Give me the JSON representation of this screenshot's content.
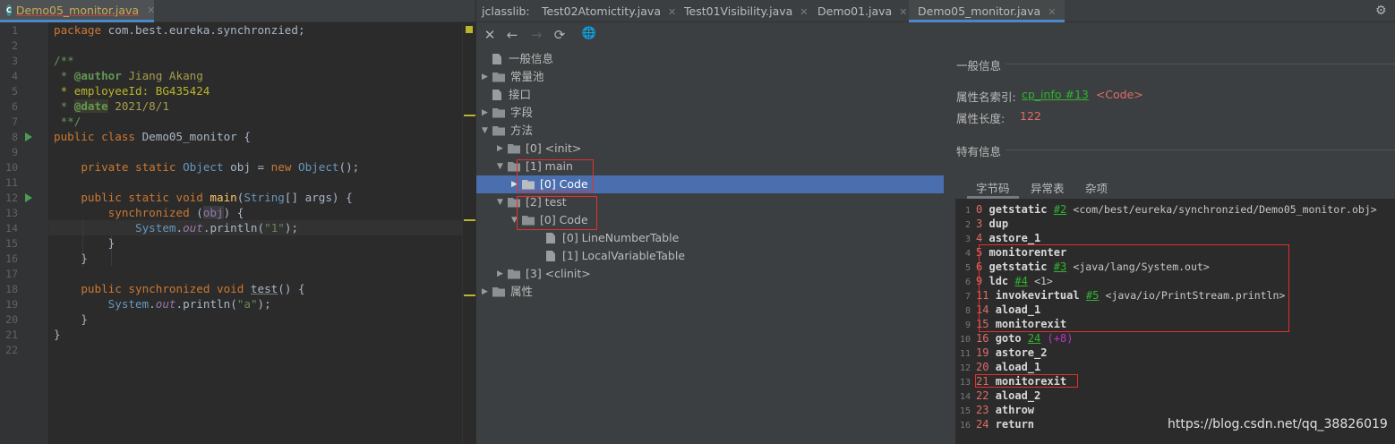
{
  "editor": {
    "tab_label": "Demo05_monitor.java",
    "tab_icon": "C",
    "lines": [
      {
        "n": "1"
      },
      {
        "n": "2"
      },
      {
        "n": "3"
      },
      {
        "n": "4"
      },
      {
        "n": "5"
      },
      {
        "n": "6"
      },
      {
        "n": "7"
      },
      {
        "n": "8"
      },
      {
        "n": "9"
      },
      {
        "n": "10"
      },
      {
        "n": "11"
      },
      {
        "n": "12"
      },
      {
        "n": "13"
      },
      {
        "n": "14"
      },
      {
        "n": "15"
      },
      {
        "n": "16"
      },
      {
        "n": "17"
      },
      {
        "n": "18"
      },
      {
        "n": "19"
      },
      {
        "n": "20"
      },
      {
        "n": "21"
      },
      {
        "n": "22"
      }
    ],
    "code": {
      "l1_kw": "package",
      "l1_rest": " com.best.eureka.synchronzied;",
      "l3": "/**",
      "l4_a": " * ",
      "l4_tag": "@author",
      "l4_rest": " Jiang Akang",
      "l5": " * employeeId: BG435424",
      "l6_a": " * ",
      "l6_tag": "@date",
      "l6_rest": " 2021/8/1",
      "l7": " **/",
      "l8_kw": "public class",
      "l8_rest": " Demo05_monitor {",
      "l10_kw": "private static",
      "l10_t": "Object",
      "l10_a": " obj = ",
      "l10_kw2": "new",
      "l10_t2": "Object",
      "l10_b": "();",
      "l12_kw": "public static void",
      "l12_fn": "main",
      "l12_a": "(",
      "l12_t": "String",
      "l12_b": "[] args) {",
      "l13_kw": "synchronized",
      "l13_a": " (",
      "l13_v": "obj",
      "l13_b": ") {",
      "l14_t": "System",
      "l14_dot": ".",
      "l14_f": "out",
      "l14_a": ".",
      "l14_m": "println",
      "l14_b": "(",
      "l14_s": "\"1\"",
      "l14_c": ");",
      "l15": "}",
      "l16": "}",
      "l18_kw": "public synchronized void",
      "l18_fn": "test",
      "l18_a": "() {",
      "l19_t": "System",
      "l19_dot": ".",
      "l19_f": "out",
      "l19_a": ".",
      "l19_m": "println",
      "l19_b": "(",
      "l19_s": "\"a\"",
      "l19_c": ");",
      "l20": "}",
      "l21": "}"
    }
  },
  "jclasslib": {
    "title": "jclasslib:",
    "tabs": [
      "Test02Atomictity.java",
      "Test01Visibility.java",
      "Demo01.java",
      "Demo05_monitor.java"
    ],
    "active_tab": "Demo05_monitor.java",
    "toolbar": {
      "close": "✕",
      "back": "←",
      "forward": "→",
      "refresh": "⟳",
      "web": "🌐"
    },
    "tree": {
      "general": "一般信息",
      "constant_pool": "常量池",
      "interfaces": "接口",
      "fields": "字段",
      "methods": "方法",
      "init": "[0] <init>",
      "main": "[1] main",
      "main_code": "[0] Code",
      "test": "[2] test",
      "test_code": "[0] Code",
      "lnt": "[0] LineNumberTable",
      "lvt": "[1] LocalVariableTable",
      "clinit": "[3] <clinit>",
      "attributes": "属性"
    },
    "details": {
      "general_title": "一般信息",
      "name_index_label": "属性名索引:",
      "name_index_link": "cp_info #13",
      "name_index_value": "<Code>",
      "length_label": "属性长度:",
      "length_value": "122",
      "specific_title": "特有信息",
      "tabs": [
        "字节码",
        "异常表",
        "杂项"
      ],
      "active_tab": "字节码"
    },
    "bytecode": [
      {
        "line": "1",
        "off": "0",
        "op": "getstatic",
        "cp": "#2",
        "arg": "<com/best/eureka/synchronzied/Demo05_monitor.obj>"
      },
      {
        "line": "2",
        "off": "3",
        "op": "dup"
      },
      {
        "line": "3",
        "off": "4",
        "op": "astore_1"
      },
      {
        "line": "4",
        "off": "5",
        "op": "monitorenter"
      },
      {
        "line": "5",
        "off": "6",
        "op": "getstatic",
        "cp": "#3",
        "arg": "<java/lang/System.out>"
      },
      {
        "line": "6",
        "off": "9",
        "op": "ldc",
        "cp": "#4",
        "arg": "<1>"
      },
      {
        "line": "7",
        "off": "11",
        "op": "invokevirtual",
        "cp": "#5",
        "arg": "<java/io/PrintStream.println>"
      },
      {
        "line": "8",
        "off": "14",
        "op": "aload_1"
      },
      {
        "line": "9",
        "off": "15",
        "op": "monitorexit"
      },
      {
        "line": "10",
        "off": "16",
        "op": "goto",
        "jmp": "24",
        "rel": "(+8)"
      },
      {
        "line": "11",
        "off": "19",
        "op": "astore_2"
      },
      {
        "line": "12",
        "off": "20",
        "op": "aload_1"
      },
      {
        "line": "13",
        "off": "21",
        "op": "monitorexit"
      },
      {
        "line": "14",
        "off": "22",
        "op": "aload_2"
      },
      {
        "line": "15",
        "off": "23",
        "op": "athrow"
      },
      {
        "line": "16",
        "off": "24",
        "op": "return"
      }
    ],
    "watermark": "https://blog.csdn.net/qq_38826019"
  }
}
